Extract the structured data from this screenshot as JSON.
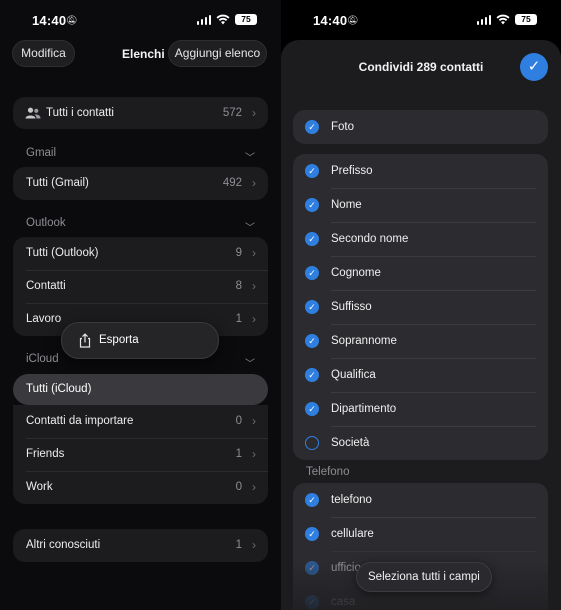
{
  "left": {
    "status": {
      "time": "14:40",
      "battery": "75"
    },
    "nav": {
      "edit": "Modifica",
      "title": "Elenchi",
      "add_list": "Aggiungi elenco"
    },
    "all_contacts": {
      "label": "Tutti i contatti",
      "count": "572"
    },
    "gmail": {
      "header": "Gmail",
      "rows": [
        {
          "label": "Tutti (Gmail)",
          "count": "492"
        }
      ]
    },
    "outlook": {
      "header": "Outlook",
      "rows": [
        {
          "label": "Tutti (Outlook)",
          "count": "9"
        },
        {
          "label": "Contatti",
          "count": "8"
        },
        {
          "label": "Lavoro",
          "count": "1"
        }
      ]
    },
    "context_menu": {
      "export": "Esporta"
    },
    "icloud": {
      "header": "iCloud",
      "selected": "Tutti (iCloud)",
      "rows": [
        {
          "label": "Contatti da importare",
          "count": "0"
        },
        {
          "label": "Friends",
          "count": "1"
        },
        {
          "label": "Work",
          "count": "0"
        }
      ]
    },
    "others": {
      "label": "Altri conosciuti",
      "count": "1"
    }
  },
  "right": {
    "status": {
      "time": "14:40",
      "battery": "75"
    },
    "sheet": {
      "title": "Condividi 289 contatti"
    },
    "photo": {
      "label": "Foto",
      "checked": true
    },
    "name_fields": [
      {
        "label": "Prefisso",
        "checked": true
      },
      {
        "label": "Nome",
        "checked": true
      },
      {
        "label": "Secondo nome",
        "checked": true
      },
      {
        "label": "Cognome",
        "checked": true
      },
      {
        "label": "Suffisso",
        "checked": true
      },
      {
        "label": "Soprannome",
        "checked": true
      },
      {
        "label": "Qualifica",
        "checked": true
      },
      {
        "label": "Dipartimento",
        "checked": true
      },
      {
        "label": "Società",
        "checked": false
      }
    ],
    "phone_header": "Telefono",
    "phone_fields": [
      {
        "label": "telefono",
        "checked": true
      },
      {
        "label": "cellulare",
        "checked": true
      },
      {
        "label": "ufficio",
        "checked": true
      },
      {
        "label": "casa",
        "checked": true
      }
    ],
    "select_all": "Seleziona tutti i campi"
  },
  "icons": {
    "accent": "#2f7fe0",
    "people": "people-icon",
    "share": "share-icon",
    "check": "checkmark-icon"
  }
}
